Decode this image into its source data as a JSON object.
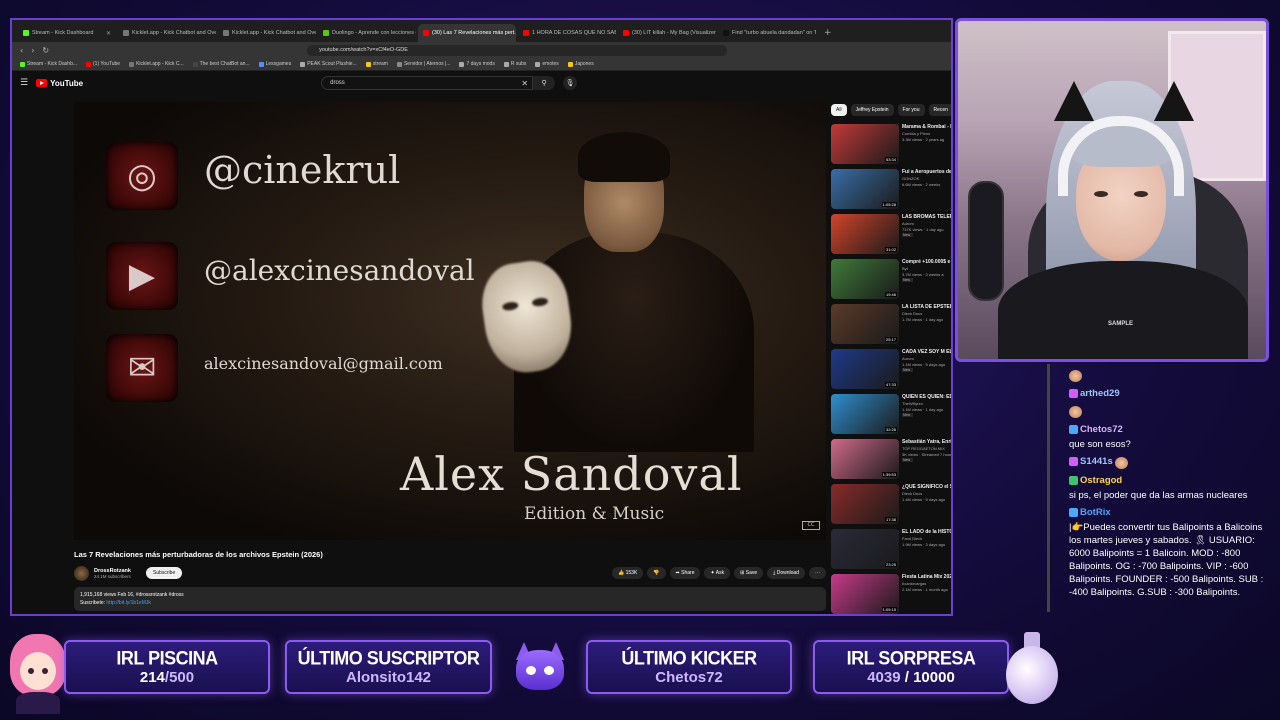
{
  "browser": {
    "tabs": [
      {
        "label": "Stream - Kick Dashboard",
        "color": "#53fc18",
        "active": false
      },
      {
        "label": "Kicklet.app - Kick Chatbot and Overl...",
        "color": "#777777",
        "active": false
      },
      {
        "label": "Kicklet.app - Kick Chatbot and Overl...",
        "color": "#777777",
        "active": false
      },
      {
        "label": "Duolingo - Aprende con lecciones d...",
        "color": "#58cc02",
        "active": false
      },
      {
        "label": "(30) Las 7 Revelaciones más pert...",
        "color": "#ff0000",
        "active": true
      },
      {
        "label": "1 HORA DE COSAS QUE NO SABÍAS",
        "color": "#ff0000",
        "active": false
      },
      {
        "label": "(30) LIT killah - My Bag (Visualizer)",
        "color": "#ff0000",
        "active": false
      },
      {
        "label": "Find \"turbo abuela dandadan\" on Tik...",
        "color": "#111111",
        "active": false
      }
    ],
    "url": "youtube.com/watch?v=xCf4eO-GDE",
    "bookmarks": [
      "Stream - Kick Dashb...",
      "(1) YouTube",
      "Kicklet.app - Kick C...",
      "The best ChatBot an...",
      "Lessgames",
      "PEAK Scout Plushie...",
      "stream",
      "Servidor | Aternos |...",
      "7 days mods",
      "R subs",
      "emotes",
      "Japones"
    ]
  },
  "youtube": {
    "logo": "YouTube",
    "search_value": "dross",
    "video": {
      "handle_instagram": "@cinekrul",
      "handle_youtube": "@alexcinesandoval",
      "email": "alexcinesandoval@gmail.com",
      "name": "Alex Sandoval",
      "subtitle": "Edition & Music",
      "cc": "CC"
    },
    "title": "Las 7 Revelaciones más perturbadoras de los archivos Epstein (2026)",
    "channel": {
      "name": "DrossRotzank",
      "subs": "24.1M subscribers",
      "subscribe": "Subscribe"
    },
    "actions": {
      "like": "153K",
      "share": "Share",
      "ask": "Ask",
      "save": "Save",
      "download": "Download"
    },
    "description": {
      "stats": "1,915,168 views  Feb 16,  #drossrotzank #dross",
      "line2_label": "Suscribete: ",
      "line2_link": "http://bit.ly/1b1eMJk"
    },
    "chips": [
      "All",
      "Jeffrey Epstein",
      "For you",
      "Recen"
    ],
    "recommendations": [
      {
        "title": "Marama & Rombai - Enganchados Cumbi...",
        "channel": "Cumbia y Pleno",
        "meta": "3.3M views · 2 years ag",
        "duration": "53:34",
        "color": "#c43a3a"
      },
      {
        "title": "Fui a Aeropuertos de...",
        "channel": "GONZOK",
        "meta": "6.6M views · 2 weeks",
        "duration": "1:05:28",
        "color": "#3a6ea8"
      },
      {
        "title": "LAS BROMAS TELEFÓNICAS VUEL...",
        "channel": "Aurom",
        "meta": "737K views · 1 day ago",
        "duration": "31:02",
        "color": "#d2442a"
      },
      {
        "title": "Compré +100.000$ e Misteriosas de País...",
        "channel": "Byt",
        "meta": "3.7M views · 3 weeks a",
        "duration": "19:46",
        "color": "#3f7a3a"
      },
      {
        "title": "LA LISTA DE EPSTEIN están y por qué NAD...",
        "channel": "Dleck Docs",
        "meta": "1.7M views · 1 day ago",
        "duration": "25:17",
        "color": "#5a3a2a"
      },
      {
        "title": "CADA VEZ SOY M EL NUEVO AMONG U...",
        "channel": "Aurom",
        "meta": "1.1M views · 5 days ago",
        "duration": "47:33",
        "color": "#1e3a8a"
      },
      {
        "title": "QUIÉN ES QUIÉN: EDICIÓN FAMOSOS",
        "channel": "TheWillyrex",
        "meta": "1.1M views · 1 day ago",
        "duration": "32:26",
        "color": "#2f8fd0"
      },
      {
        "title": "Sebastián Yatra, Enrique Iglesias, Manuel Turizo,...",
        "channel": "TOP REGGAETON MIX",
        "meta": "3K views · Streamed 7 hours ago",
        "duration": "1:39:53",
        "color": "#d06a8a"
      },
      {
        "title": "¿QUÉ SIGNIFICÓ el SUPER BOWL de BAD BUNNY para los...",
        "channel": "Dleck Docs",
        "meta": "1.4M views · 5 days ago",
        "duration": "17:38",
        "color": "#8a2a2a"
      },
      {
        "title": "EL LADO de la HISTORIA que NADIE CONTÓ | Michael ...",
        "channel": "Fand Dleck",
        "meta": "1.9M views · 3 days ago",
        "duration": "23:25",
        "color": "#2a2a3a"
      },
      {
        "title": "Fiesta Latina Mix 2025 🎉 | Hora Loca 🎊 | Musica Latina ...",
        "channel": "ricardovargas",
        "meta": "2.1M views · 1 month ago",
        "duration": "1:05:15",
        "color": "#c83a8a"
      }
    ],
    "badge_new": "New"
  },
  "chat": {
    "messages": [
      {
        "user": "",
        "color": "#ffffff",
        "text": "",
        "emote": true
      },
      {
        "user": "arthed29",
        "color": "#9ec6ff",
        "text": "",
        "emote": false
      },
      {
        "user": "",
        "color": "#ffffff",
        "text": "",
        "emote": true
      },
      {
        "user": "Chetos72",
        "color": "#d9b3ff",
        "text": "que son esos?",
        "emote": false
      },
      {
        "user": "S1441s",
        "color": "#9ec6ff",
        "text": "",
        "emote": true
      },
      {
        "user": "Ostragod",
        "color": "#ffd54a",
        "text": "si ps, el poder que da las armas nucleares",
        "emote": false
      },
      {
        "user": "BotRix",
        "color": "#4aa8ff",
        "text": "|👉Puedes convertir tus Balipoints a Balicoins los martes jueves y sabados. 🎗 USUARIO: 6000 Balipoints = 1 Balicoin. MOD : -800 Balipoints. OG : -700 Balipoints. VIP : -600 Balipoints. FOUNDER : -500 Balipoints. SUB : -400 Balipoints. G.SUB : -300 Balipoints.",
        "emote": false
      }
    ]
  },
  "overlay": {
    "panels": [
      {
        "title": "IRL PISCINA",
        "value_a": "214",
        "value_b": "/500"
      },
      {
        "title": "ÚLTIMO SUSCRIPTOR",
        "value": "Alonsito142"
      },
      {
        "title": "ÚLTIMO KICKER",
        "value": "Chetos72"
      },
      {
        "title": "IRL SORPRESA",
        "value_a": "4039",
        "value_b": " / 10000"
      }
    ]
  },
  "webcam": {
    "shirt_text": "SAMPLE"
  }
}
